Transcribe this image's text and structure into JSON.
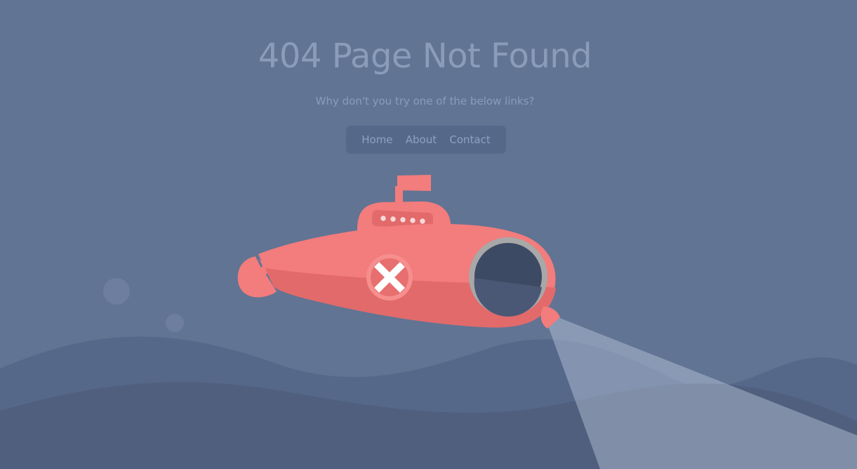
{
  "page": {
    "title": "404 Page Not Found",
    "subtitle": "Why don't you try one of the below links?"
  },
  "nav": {
    "links": [
      {
        "label": "Home"
      },
      {
        "label": "About"
      },
      {
        "label": "Contact"
      }
    ]
  },
  "colors": {
    "background": "#617493",
    "title_text": "#8b9cbb",
    "nav_background": "#56688a",
    "wave_back": "#56688a",
    "wave_front": "#505f7d",
    "submarine_body": "#f37c7c",
    "submarine_shade": "#e26a6a",
    "porthole_frame": "#a8a8a8",
    "porthole_glass": "#3d4a63"
  },
  "illustration": {
    "subject": "submarine-with-searchlight",
    "window_icon": "cross-icon"
  }
}
